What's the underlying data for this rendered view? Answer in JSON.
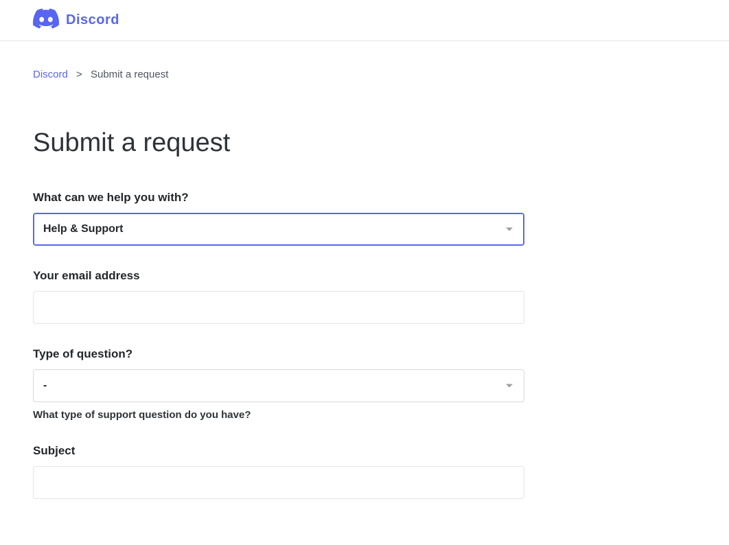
{
  "header": {
    "brand_text": "Discord"
  },
  "breadcrumbs": {
    "root_link": "Discord",
    "separator": ">",
    "current": "Submit a request"
  },
  "page": {
    "title": "Submit a request"
  },
  "form": {
    "help_with": {
      "label": "What can we help you with?",
      "selected": "Help & Support"
    },
    "email": {
      "label": "Your email address",
      "value": ""
    },
    "question_type": {
      "label": "Type of question?",
      "selected": "-",
      "help_text": "What type of support question do you have?"
    },
    "subject": {
      "label": "Subject",
      "value": ""
    }
  }
}
